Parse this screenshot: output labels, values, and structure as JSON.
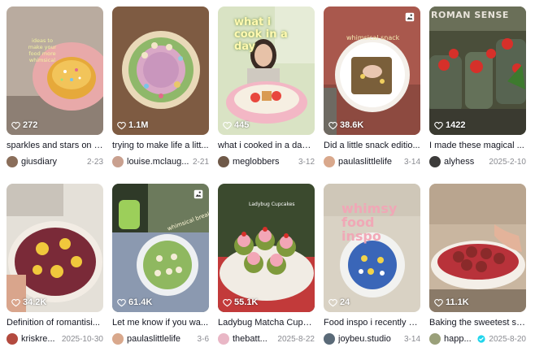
{
  "colors": {
    "heart": "#ffffff",
    "verified": "#20d5ec"
  },
  "icons": {
    "views": "heart-outline-icon",
    "slides": "photo-carousel-icon",
    "verified": "verified-badge-icon"
  },
  "cards": [
    {
      "views": "272",
      "caption": "sparkles and stars on e...",
      "author": "giusdiary",
      "date": "2-23",
      "overlay": "ideas to make your food more whimsical",
      "avatar_color": "#8a6e5a"
    },
    {
      "views": "1.1M",
      "caption": "trying to make life a litt...",
      "author": "louise.mclaug...",
      "date": "2-21",
      "overlay": "",
      "avatar_color": "#c9a08f"
    },
    {
      "views": "445",
      "caption": "what i cooked in a day!...",
      "author": "meglobbers",
      "date": "3-12",
      "overlay": "what i cook in a day",
      "avatar_color": "#6f5948"
    },
    {
      "views": "38.6K",
      "caption": "Did a little snack editio...",
      "author": "paulaslittlelife",
      "date": "3-14",
      "overlay": "whimsical snack",
      "avatar_color": "#d9a88c"
    },
    {
      "views": "1422",
      "caption": "I made these magical ...",
      "author": "alyhess",
      "date": "2025-2-10",
      "overlay": "ROMAN SENSE",
      "avatar_color": "#3c3b3a"
    },
    {
      "views": "34.2K",
      "caption": "Definition of romantisi...",
      "author": "kriskre...",
      "date": "2025-10-30",
      "overlay": "",
      "avatar_color": "#b34a3f"
    },
    {
      "views": "61.4K",
      "caption": "Let me know if you wa...",
      "author": "paulaslittlelife",
      "date": "3-6",
      "overlay": "whimsical breakfast",
      "avatar_color": "#d9a88c"
    },
    {
      "views": "55.1K",
      "caption": "Ladybug Matcha Cupc...",
      "author": "thebatt...",
      "date": "2025-8-22",
      "overlay": "Ladybug Cupcakes",
      "avatar_color": "#e9b7c6"
    },
    {
      "views": "24",
      "caption": "Food inspo i recently s...",
      "author": "joybeu.studio",
      "date": "3-14",
      "overlay": "whimsy food inspo",
      "avatar_color": "#5a6a78"
    },
    {
      "views": "11.1K",
      "caption": "Baking the sweetest st...",
      "author": "happ...",
      "date": "2025-8-20",
      "overlay": "",
      "avatar_color": "#9aa07a"
    }
  ]
}
